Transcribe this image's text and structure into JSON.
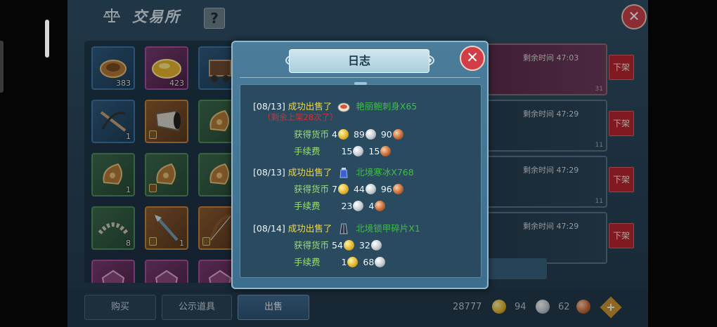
{
  "screen": {
    "title": "交易所",
    "help_label": "?",
    "close_label": "✕"
  },
  "inventory": {
    "slots": [
      {
        "icon": "saddle-icon",
        "rarity": "blue",
        "count": "383",
        "locked": false
      },
      {
        "icon": "gold-ingot-icon",
        "rarity": "purple",
        "count": "423",
        "locked": false
      },
      {
        "icon": "lantern-cart-icon",
        "rarity": "blue",
        "count": "",
        "locked": false
      },
      {
        "icon": "crossbow-icon",
        "rarity": "blue",
        "count": "1",
        "locked": false
      },
      {
        "icon": "horn-icon",
        "rarity": "orange",
        "count": "",
        "locked": true
      },
      {
        "icon": "pouch-icon",
        "rarity": "green",
        "count": "",
        "locked": false
      },
      {
        "icon": "pouch-icon",
        "rarity": "green",
        "count": "1",
        "locked": false
      },
      {
        "icon": "pouch-icon",
        "rarity": "green",
        "count": "",
        "locked": true
      },
      {
        "icon": "pouch-icon",
        "rarity": "green",
        "count": "",
        "locked": false
      },
      {
        "icon": "wreath-icon",
        "rarity": "green",
        "count": "8",
        "locked": false
      },
      {
        "icon": "spear-icon",
        "rarity": "orange",
        "count": "1",
        "locked": true
      },
      {
        "icon": "bow-icon",
        "rarity": "orange",
        "count": "",
        "locked": true
      },
      {
        "icon": "armor-icon",
        "rarity": "purple",
        "count": "",
        "locked": false
      },
      {
        "icon": "armor-icon",
        "rarity": "purple",
        "count": "",
        "locked": false
      },
      {
        "icon": "armor-icon",
        "rarity": "purple",
        "count": "",
        "locked": false
      }
    ]
  },
  "listings": [
    {
      "time_label": "剩余时间",
      "time": "47:03",
      "style": "purple",
      "unlist_label": "下架",
      "num": "31"
    },
    {
      "time_label": "剩余时间",
      "time": "47:29",
      "style": "teal",
      "unlist_label": "下架",
      "num": "11"
    },
    {
      "time_label": "剩余时间",
      "time": "47:29",
      "style": "teal",
      "unlist_label": "下架",
      "num": "11"
    },
    {
      "time_label": "剩余时间",
      "time": "47:29",
      "style": "teal",
      "unlist_label": "下架",
      "num": ""
    }
  ],
  "tabs": {
    "buy": "购买",
    "public": "公示道具",
    "sell": "出售"
  },
  "wallet": {
    "gold": "28777",
    "silver": "94",
    "copper": "62",
    "add_label": "+"
  },
  "log_dialog": {
    "title": "日志",
    "close_label": "✕",
    "entries": [
      {
        "date": "[08/13]",
        "action": "成功出售了",
        "item_icon": "meat-dish-icon",
        "item": "艳丽鲍刺身X65",
        "warning": "（剩余上架28次了）",
        "income_label": "获得货币",
        "income": {
          "gold": "4",
          "silver": "89",
          "copper": "90"
        },
        "fee_label": "手续费",
        "fee": {
          "silver": "15",
          "copper": "15"
        }
      },
      {
        "date": "[08/13]",
        "action": "成功出售了",
        "item_icon": "blue-bottle-icon",
        "item": "北境寒冰X768",
        "income_label": "获得货币",
        "income": {
          "gold": "7",
          "silver": "44",
          "copper": "96"
        },
        "fee_label": "手续费",
        "fee": {
          "silver": "23",
          "copper": "4"
        }
      },
      {
        "date": "[08/14]",
        "action": "成功出售了",
        "item_icon": "dark-robe-icon",
        "item": "北境锁甲碎片X1",
        "income_label": "获得货币",
        "income": {
          "gold": "54",
          "silver": "32"
        },
        "fee_label": "手续费",
        "fee": {
          "gold": "1",
          "silver": "68"
        }
      }
    ]
  }
}
